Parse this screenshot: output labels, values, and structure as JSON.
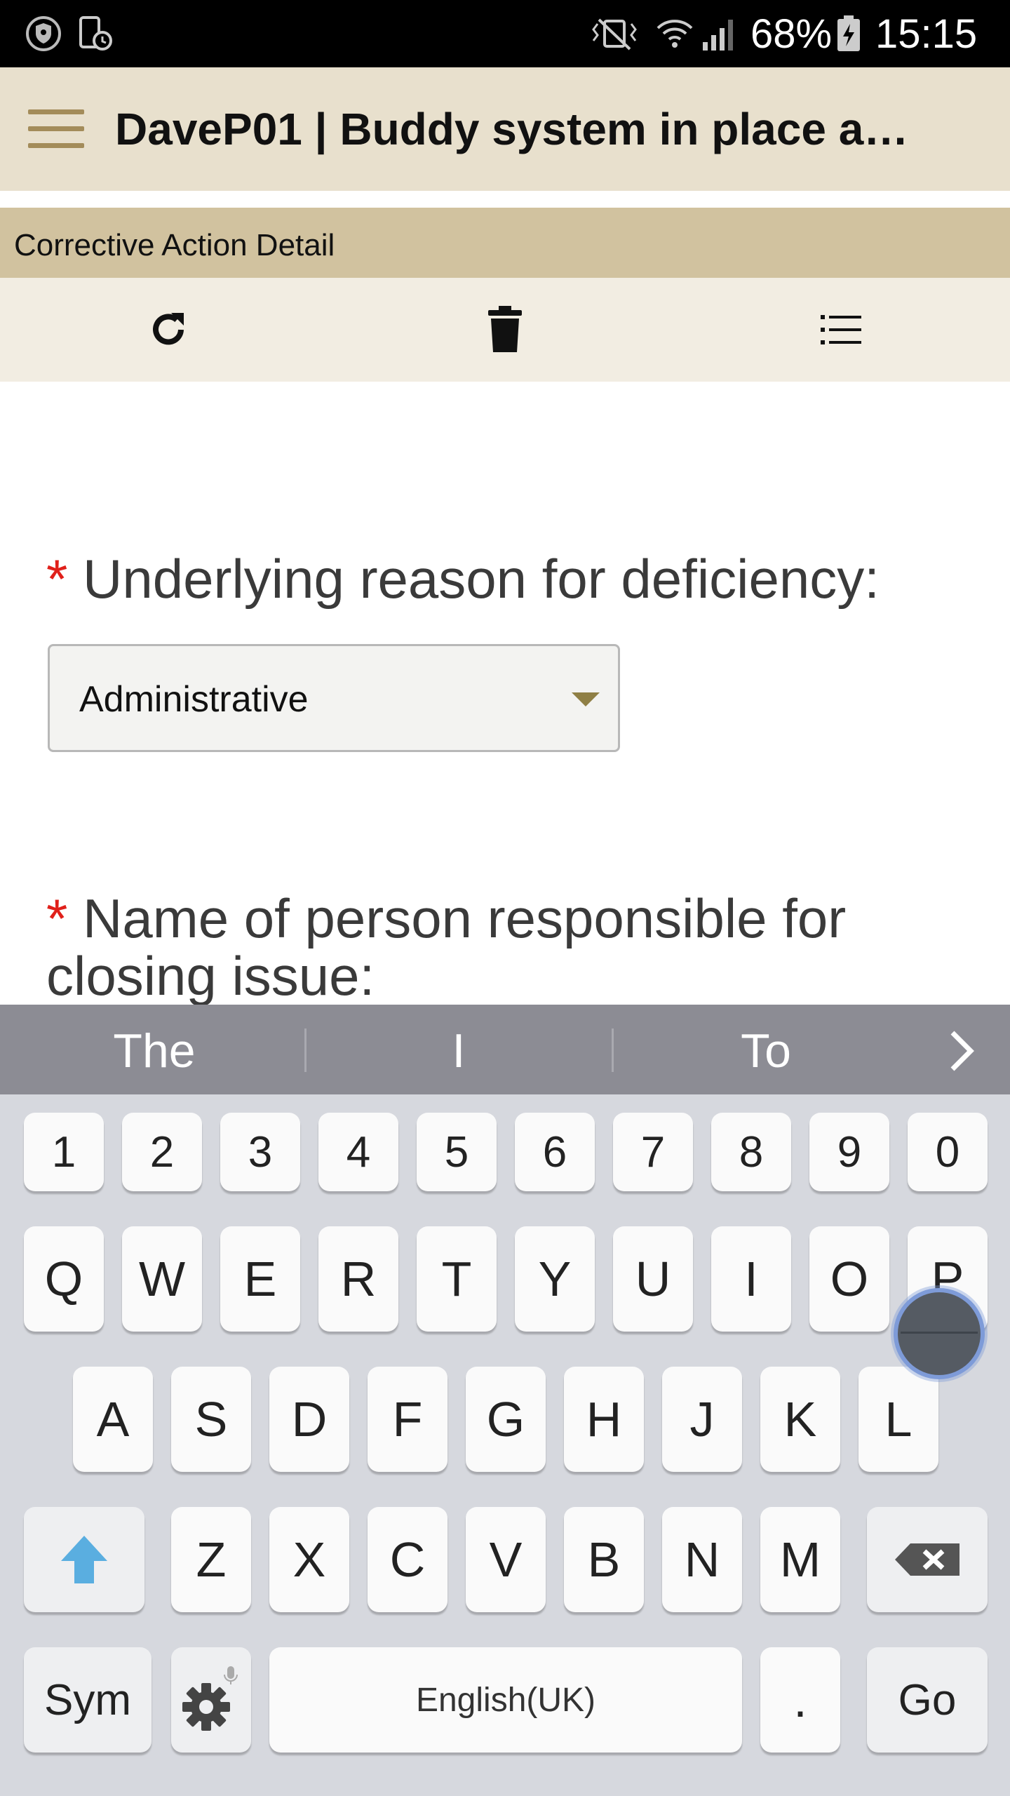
{
  "status_bar": {
    "battery_percent": "68%",
    "time": "15:15",
    "icons": [
      "vpn-shield-icon",
      "screen-lock-icon",
      "vibrate-mute-icon",
      "wifi-icon",
      "signal-icon",
      "battery-charging-icon"
    ]
  },
  "app_bar": {
    "title": "DaveP01 | Buddy system in place a…",
    "menu_icon": "hamburger-menu-icon"
  },
  "section": {
    "title": "Corrective Action Detail"
  },
  "toolbar": {
    "buttons": [
      {
        "icon": "refresh-icon"
      },
      {
        "icon": "trash-icon"
      },
      {
        "icon": "list-icon"
      }
    ]
  },
  "form": {
    "required_marker": "*",
    "reason_label": "Underlying reason for deficiency:",
    "reason_value": "Administrative",
    "person_label": "Name of person responsible for closing issue:"
  },
  "keyboard": {
    "suggestions": [
      "The",
      "I",
      "To"
    ],
    "number_row": [
      "1",
      "2",
      "3",
      "4",
      "5",
      "6",
      "7",
      "8",
      "9",
      "0"
    ],
    "row1": [
      "Q",
      "W",
      "E",
      "R",
      "T",
      "Y",
      "U",
      "I",
      "O",
      "P"
    ],
    "row2": [
      "A",
      "S",
      "D",
      "F",
      "G",
      "H",
      "J",
      "K",
      "L"
    ],
    "row3": [
      "Z",
      "X",
      "C",
      "V",
      "B",
      "N",
      "M"
    ],
    "sym_label": "Sym",
    "space_label": "English(UK)",
    "period_label": ".",
    "go_label": "Go",
    "accent_color": "#5aaee0"
  }
}
